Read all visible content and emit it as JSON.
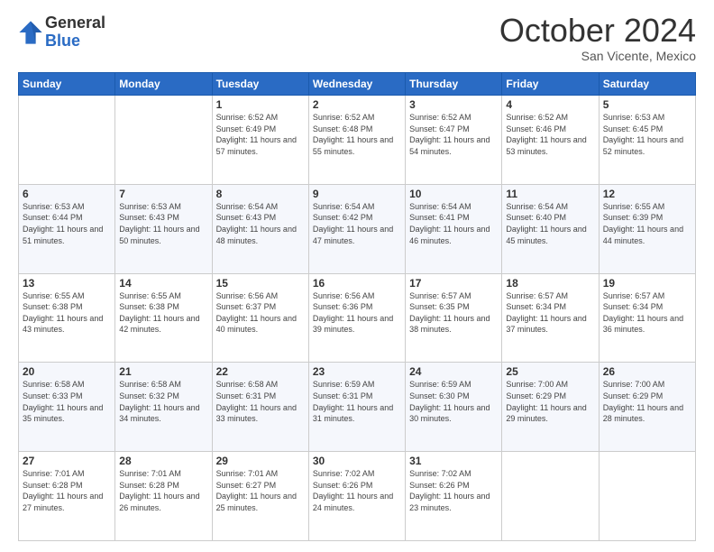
{
  "logo": {
    "general": "General",
    "blue": "Blue"
  },
  "title": "October 2024",
  "location": "San Vicente, Mexico",
  "days_of_week": [
    "Sunday",
    "Monday",
    "Tuesday",
    "Wednesday",
    "Thursday",
    "Friday",
    "Saturday"
  ],
  "weeks": [
    [
      {
        "day": "",
        "sunrise": "",
        "sunset": "",
        "daylight": "",
        "empty": true
      },
      {
        "day": "",
        "sunrise": "",
        "sunset": "",
        "daylight": "",
        "empty": true
      },
      {
        "day": "1",
        "sunrise": "Sunrise: 6:52 AM",
        "sunset": "Sunset: 6:49 PM",
        "daylight": "Daylight: 11 hours and 57 minutes."
      },
      {
        "day": "2",
        "sunrise": "Sunrise: 6:52 AM",
        "sunset": "Sunset: 6:48 PM",
        "daylight": "Daylight: 11 hours and 55 minutes."
      },
      {
        "day": "3",
        "sunrise": "Sunrise: 6:52 AM",
        "sunset": "Sunset: 6:47 PM",
        "daylight": "Daylight: 11 hours and 54 minutes."
      },
      {
        "day": "4",
        "sunrise": "Sunrise: 6:52 AM",
        "sunset": "Sunset: 6:46 PM",
        "daylight": "Daylight: 11 hours and 53 minutes."
      },
      {
        "day": "5",
        "sunrise": "Sunrise: 6:53 AM",
        "sunset": "Sunset: 6:45 PM",
        "daylight": "Daylight: 11 hours and 52 minutes."
      }
    ],
    [
      {
        "day": "6",
        "sunrise": "Sunrise: 6:53 AM",
        "sunset": "Sunset: 6:44 PM",
        "daylight": "Daylight: 11 hours and 51 minutes."
      },
      {
        "day": "7",
        "sunrise": "Sunrise: 6:53 AM",
        "sunset": "Sunset: 6:43 PM",
        "daylight": "Daylight: 11 hours and 50 minutes."
      },
      {
        "day": "8",
        "sunrise": "Sunrise: 6:54 AM",
        "sunset": "Sunset: 6:43 PM",
        "daylight": "Daylight: 11 hours and 48 minutes."
      },
      {
        "day": "9",
        "sunrise": "Sunrise: 6:54 AM",
        "sunset": "Sunset: 6:42 PM",
        "daylight": "Daylight: 11 hours and 47 minutes."
      },
      {
        "day": "10",
        "sunrise": "Sunrise: 6:54 AM",
        "sunset": "Sunset: 6:41 PM",
        "daylight": "Daylight: 11 hours and 46 minutes."
      },
      {
        "day": "11",
        "sunrise": "Sunrise: 6:54 AM",
        "sunset": "Sunset: 6:40 PM",
        "daylight": "Daylight: 11 hours and 45 minutes."
      },
      {
        "day": "12",
        "sunrise": "Sunrise: 6:55 AM",
        "sunset": "Sunset: 6:39 PM",
        "daylight": "Daylight: 11 hours and 44 minutes."
      }
    ],
    [
      {
        "day": "13",
        "sunrise": "Sunrise: 6:55 AM",
        "sunset": "Sunset: 6:38 PM",
        "daylight": "Daylight: 11 hours and 43 minutes."
      },
      {
        "day": "14",
        "sunrise": "Sunrise: 6:55 AM",
        "sunset": "Sunset: 6:38 PM",
        "daylight": "Daylight: 11 hours and 42 minutes."
      },
      {
        "day": "15",
        "sunrise": "Sunrise: 6:56 AM",
        "sunset": "Sunset: 6:37 PM",
        "daylight": "Daylight: 11 hours and 40 minutes."
      },
      {
        "day": "16",
        "sunrise": "Sunrise: 6:56 AM",
        "sunset": "Sunset: 6:36 PM",
        "daylight": "Daylight: 11 hours and 39 minutes."
      },
      {
        "day": "17",
        "sunrise": "Sunrise: 6:57 AM",
        "sunset": "Sunset: 6:35 PM",
        "daylight": "Daylight: 11 hours and 38 minutes."
      },
      {
        "day": "18",
        "sunrise": "Sunrise: 6:57 AM",
        "sunset": "Sunset: 6:34 PM",
        "daylight": "Daylight: 11 hours and 37 minutes."
      },
      {
        "day": "19",
        "sunrise": "Sunrise: 6:57 AM",
        "sunset": "Sunset: 6:34 PM",
        "daylight": "Daylight: 11 hours and 36 minutes."
      }
    ],
    [
      {
        "day": "20",
        "sunrise": "Sunrise: 6:58 AM",
        "sunset": "Sunset: 6:33 PM",
        "daylight": "Daylight: 11 hours and 35 minutes."
      },
      {
        "day": "21",
        "sunrise": "Sunrise: 6:58 AM",
        "sunset": "Sunset: 6:32 PM",
        "daylight": "Daylight: 11 hours and 34 minutes."
      },
      {
        "day": "22",
        "sunrise": "Sunrise: 6:58 AM",
        "sunset": "Sunset: 6:31 PM",
        "daylight": "Daylight: 11 hours and 33 minutes."
      },
      {
        "day": "23",
        "sunrise": "Sunrise: 6:59 AM",
        "sunset": "Sunset: 6:31 PM",
        "daylight": "Daylight: 11 hours and 31 minutes."
      },
      {
        "day": "24",
        "sunrise": "Sunrise: 6:59 AM",
        "sunset": "Sunset: 6:30 PM",
        "daylight": "Daylight: 11 hours and 30 minutes."
      },
      {
        "day": "25",
        "sunrise": "Sunrise: 7:00 AM",
        "sunset": "Sunset: 6:29 PM",
        "daylight": "Daylight: 11 hours and 29 minutes."
      },
      {
        "day": "26",
        "sunrise": "Sunrise: 7:00 AM",
        "sunset": "Sunset: 6:29 PM",
        "daylight": "Daylight: 11 hours and 28 minutes."
      }
    ],
    [
      {
        "day": "27",
        "sunrise": "Sunrise: 7:01 AM",
        "sunset": "Sunset: 6:28 PM",
        "daylight": "Daylight: 11 hours and 27 minutes."
      },
      {
        "day": "28",
        "sunrise": "Sunrise: 7:01 AM",
        "sunset": "Sunset: 6:28 PM",
        "daylight": "Daylight: 11 hours and 26 minutes."
      },
      {
        "day": "29",
        "sunrise": "Sunrise: 7:01 AM",
        "sunset": "Sunset: 6:27 PM",
        "daylight": "Daylight: 11 hours and 25 minutes."
      },
      {
        "day": "30",
        "sunrise": "Sunrise: 7:02 AM",
        "sunset": "Sunset: 6:26 PM",
        "daylight": "Daylight: 11 hours and 24 minutes."
      },
      {
        "day": "31",
        "sunrise": "Sunrise: 7:02 AM",
        "sunset": "Sunset: 6:26 PM",
        "daylight": "Daylight: 11 hours and 23 minutes."
      },
      {
        "day": "",
        "sunrise": "",
        "sunset": "",
        "daylight": "",
        "empty": true
      },
      {
        "day": "",
        "sunrise": "",
        "sunset": "",
        "daylight": "",
        "empty": true
      }
    ]
  ]
}
